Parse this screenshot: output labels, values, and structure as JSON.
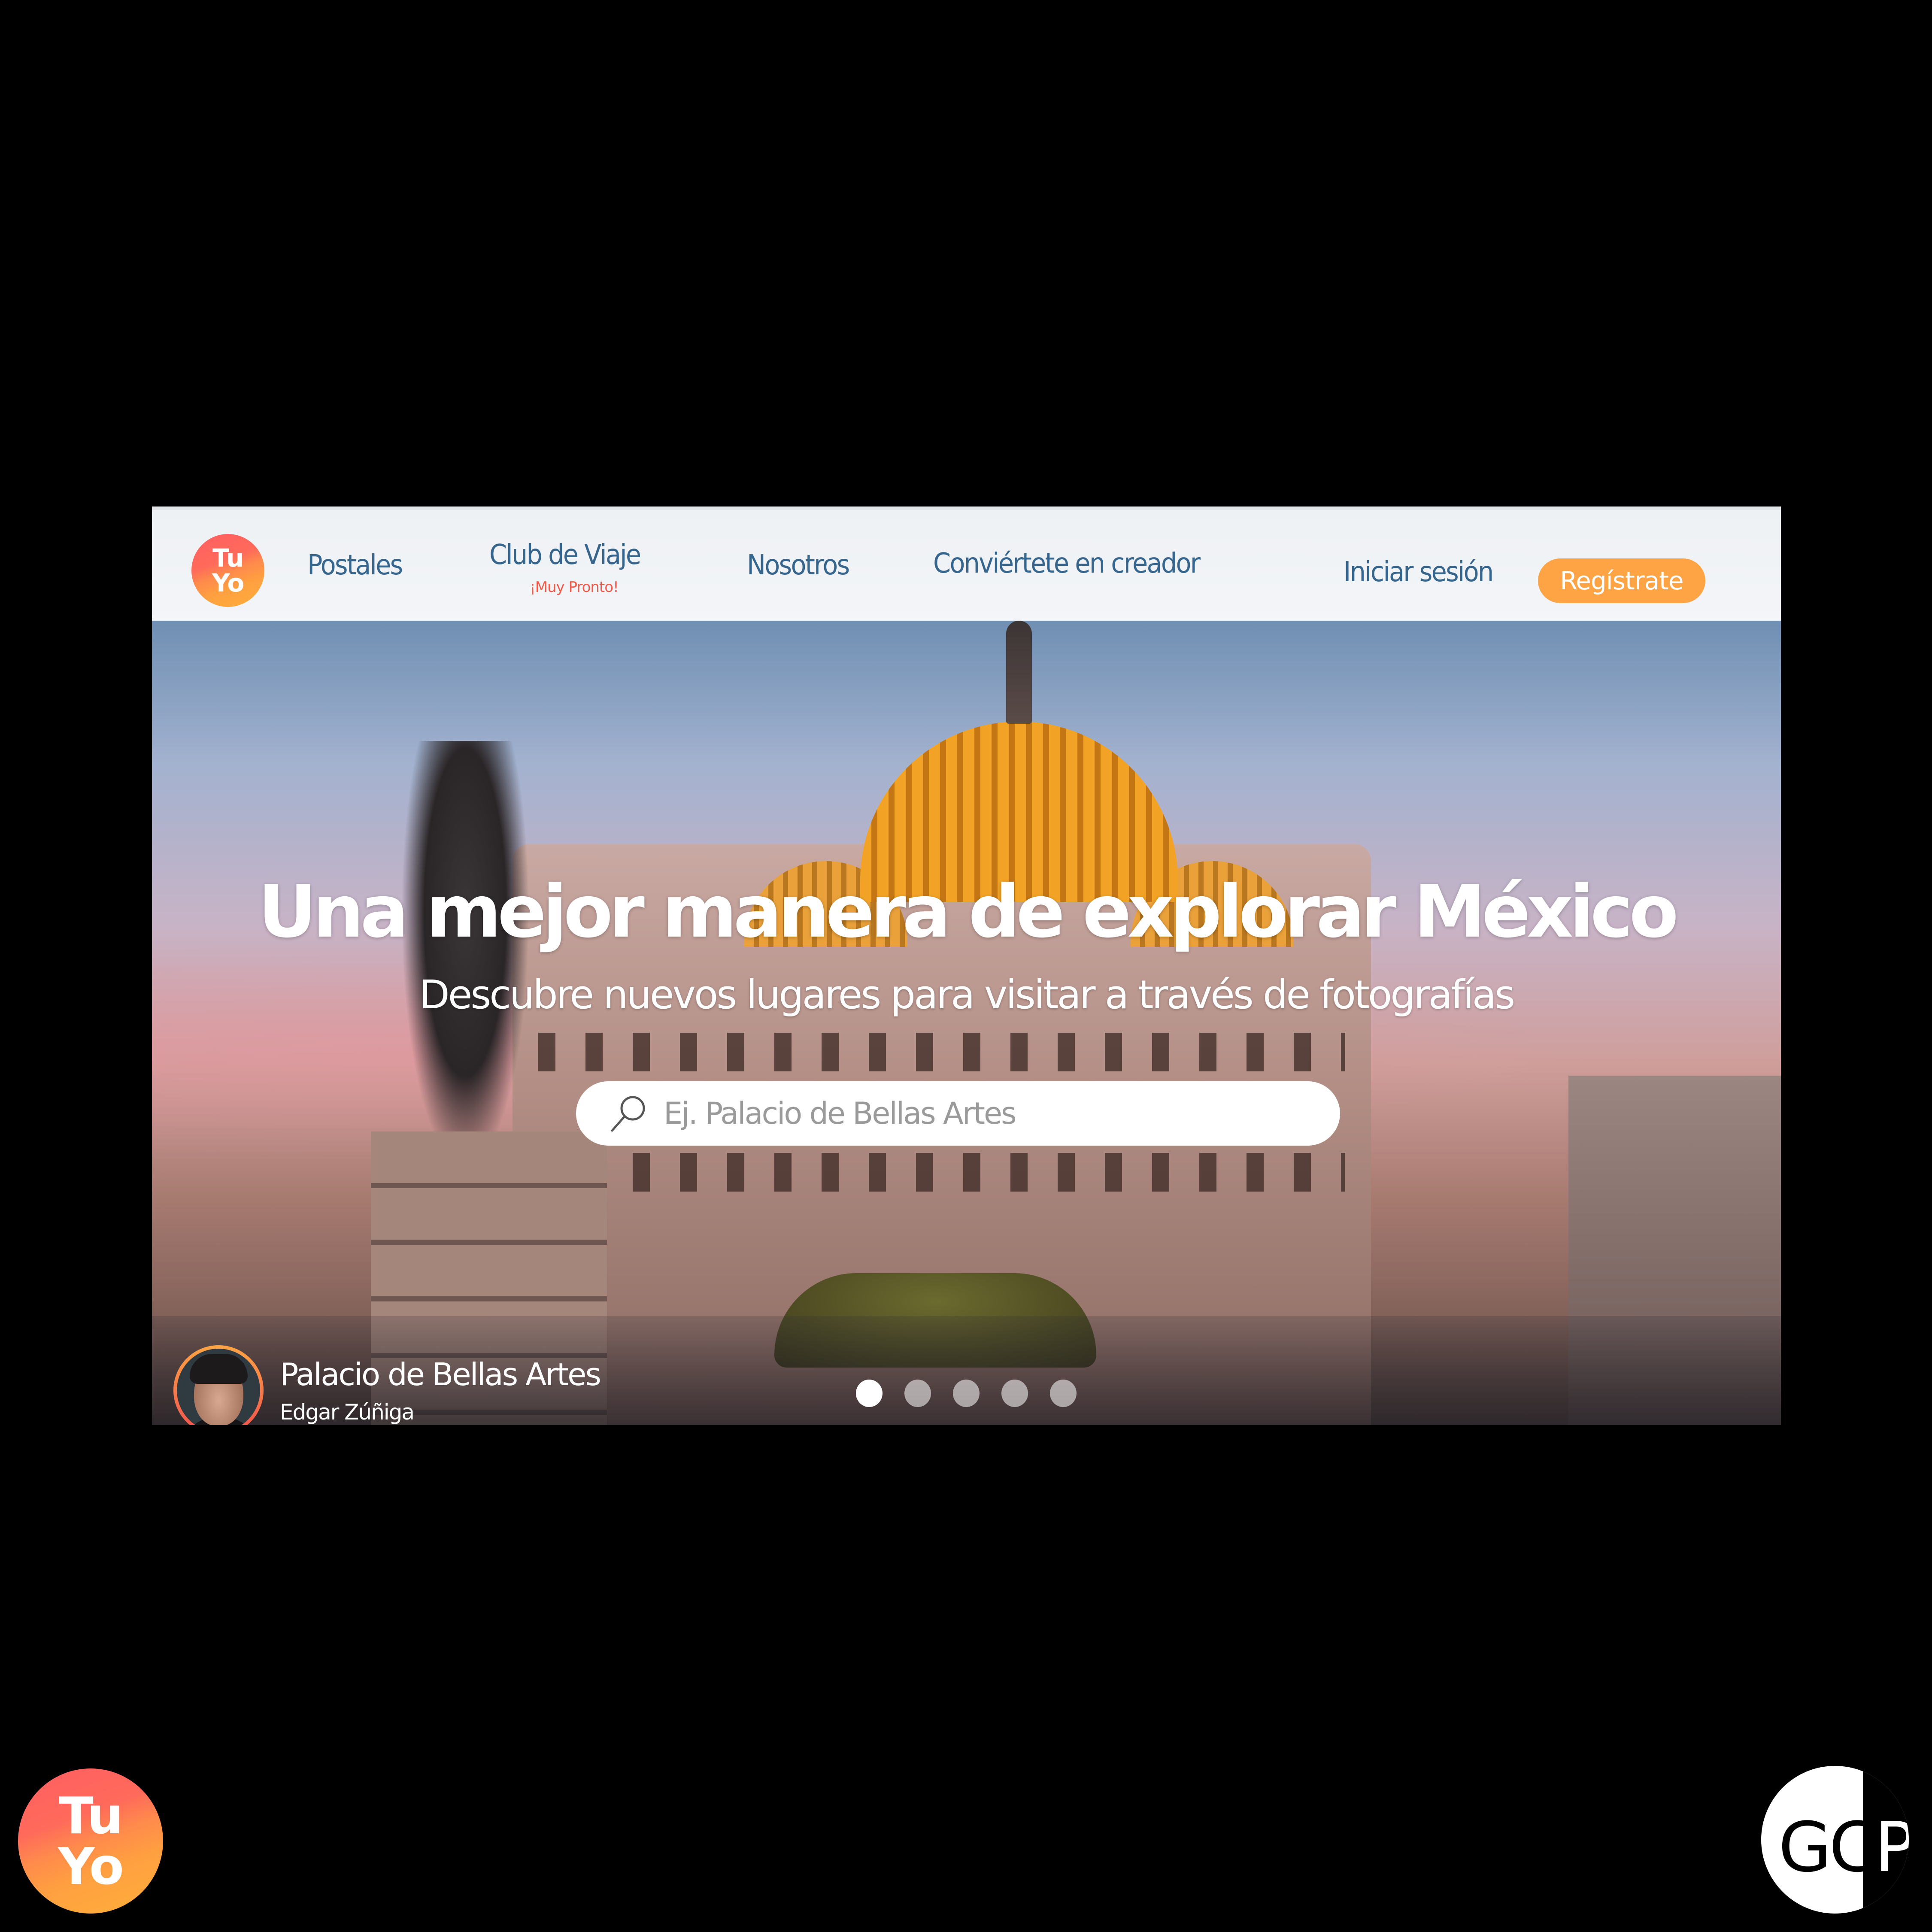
{
  "navbar": {
    "logo": {
      "line1": "Tu",
      "line2": "Yo"
    },
    "links": [
      {
        "label": "Postales"
      },
      {
        "label": "Club de Viaje",
        "sublabel": "¡Muy Pronto!"
      },
      {
        "label": "Nosotros"
      },
      {
        "label": "Conviértete en creador"
      }
    ],
    "login_label": "Iniciar sesión",
    "register_label": "Regístrate"
  },
  "hero": {
    "title": "Una mejor manera de explorar México",
    "subtitle": "Descubre nuevos lugares para visitar a través de fotografías",
    "search": {
      "placeholder": "Ej. Palacio de Bellas Artes",
      "value": "",
      "icon": "search-icon"
    },
    "photo_credit": {
      "place": "Palacio de Bellas Artes",
      "author": "Edgar Zúñiga"
    },
    "carousel": {
      "total_slides": 5,
      "active_slide": 1
    }
  },
  "watermarks": {
    "bottom_left_logo": {
      "line1": "Tu",
      "line2": "Yo"
    },
    "bottom_right_logo": {
      "text_left": "GC",
      "text_right": "P"
    }
  },
  "colors": {
    "nav_text": "#36658e",
    "accent_orange": "#ffa445",
    "coming_soon_red": "#f05a4a",
    "logo_gradient_top": "#ff5e62",
    "logo_gradient_bottom": "#ffae3a",
    "background": "#000000"
  }
}
